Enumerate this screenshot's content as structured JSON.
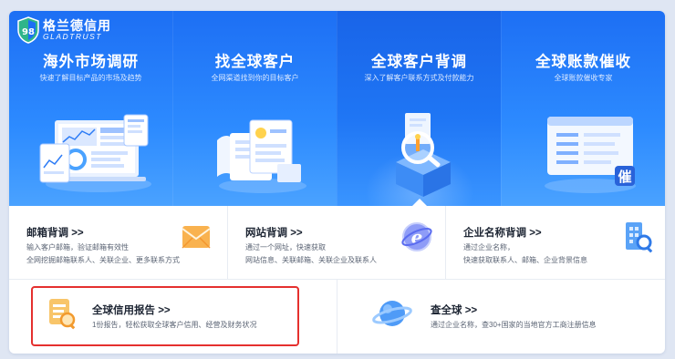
{
  "brand": {
    "logo_cn": "格兰德信用",
    "logo_en": "GLADTRUST",
    "shield_badge": "98"
  },
  "banner": [
    {
      "title": "海外市场调研",
      "subtitle": "快速了解目标产品的市场及趋势"
    },
    {
      "title": "找全球客户",
      "subtitle": "全网渠道找到你的目标客户"
    },
    {
      "title": "全球客户背调",
      "subtitle": "深入了解客户联系方式及付款能力"
    },
    {
      "title": "全球账款催收",
      "subtitle": "全球账款催收专家",
      "badge": "催"
    }
  ],
  "services_row1": [
    {
      "title": "邮箱背调 >>",
      "lines": [
        "输入客户邮箱，验证邮箱有效性",
        "全网挖掘邮箱联系人、关联企业、更多联系方式"
      ],
      "icon": "envelope-icon"
    },
    {
      "title": "网站背调 >>",
      "lines": [
        "通过一个网址，快速获取",
        "网站信息、关联邮箱、关联企业及联系人"
      ],
      "icon": "browser-e-icon"
    },
    {
      "title": "企业名称背调 >>",
      "lines": [
        "通过企业名称，",
        "快速获取联系人、邮箱、企业背景信息"
      ],
      "icon": "building-search-icon"
    }
  ],
  "services_row2": [
    {
      "title": "全球信用报告 >>",
      "lines": [
        "1份报告，轻松获取全球客户信用、经营及财务状况"
      ],
      "icon": "report-icon",
      "highlighted": true
    },
    {
      "title": "查全球 >>",
      "lines": [
        "通过企业名称，查30+国家的当地官方工商注册信息"
      ],
      "icon": "planet-icon"
    }
  ],
  "colors": {
    "banner_blue": "#1d6ff4",
    "highlight_red": "#e5302e",
    "text_dark": "#1d2533",
    "text_muted": "#5b6474"
  }
}
